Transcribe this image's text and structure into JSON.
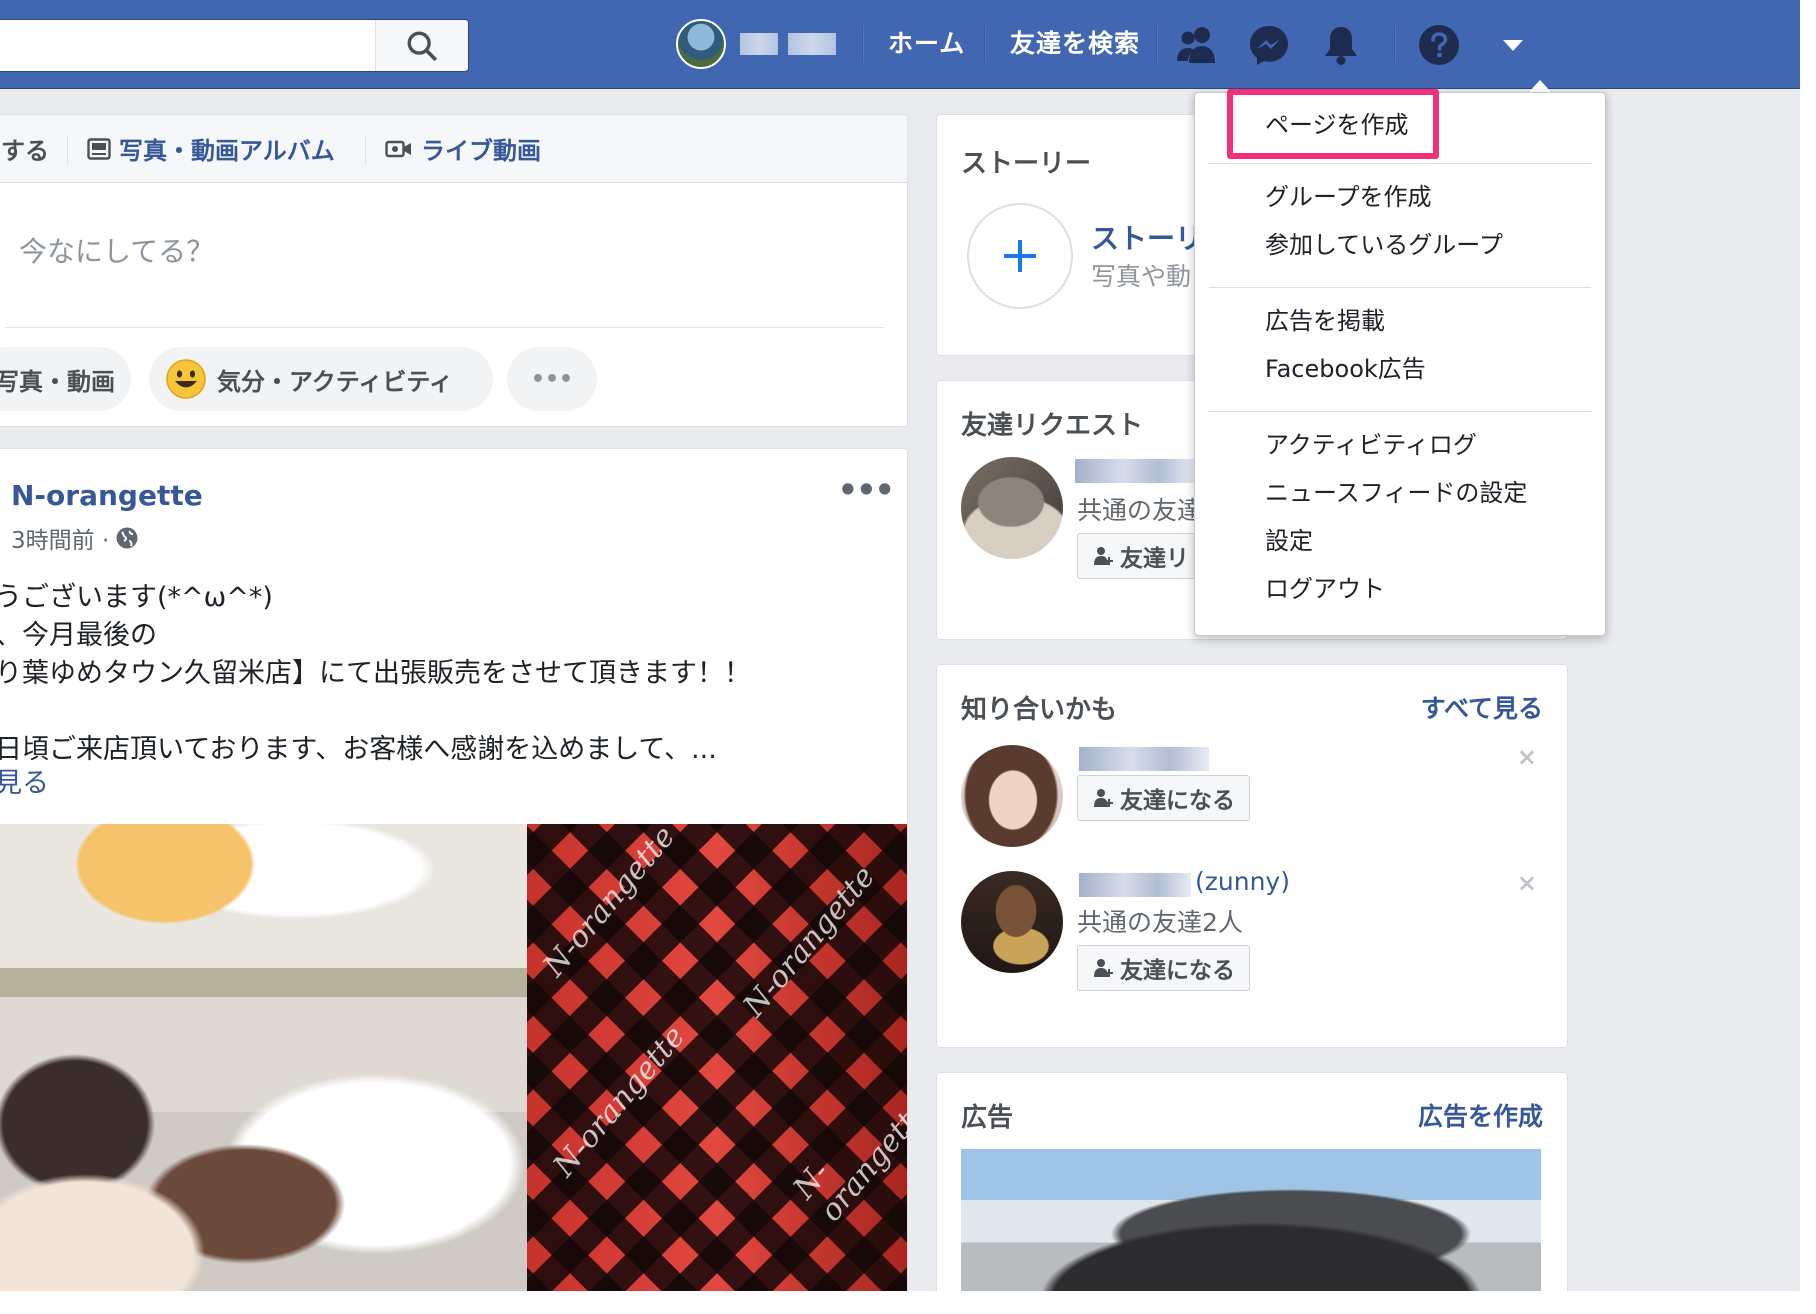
{
  "header": {
    "nav_home": "ホーム",
    "nav_find_friends": "友達を検索"
  },
  "composer": {
    "tab_post_partial": "する",
    "tab_album": "写真・動画アルバム",
    "tab_live": "ライブ動画",
    "placeholder": "今なにしてる？",
    "action_photo_partial": "写真・動画",
    "action_feeling": "気分・アクティビティ",
    "action_more": "•••"
  },
  "post": {
    "author": "N-orangette",
    "time": "3時間前 ·",
    "more": "•••",
    "lines": [
      "うございます(*^ω^*)",
      "、今月最後の",
      "り葉ゆめタウン久留米店】にて出張販売をさせて頂きます！！",
      "日頃ご来店頂いております、お客様へ感謝を込めまして、..."
    ],
    "see_more_partial": "見る",
    "image_logo_text": "N-orangette"
  },
  "stories": {
    "title": "ストーリー",
    "item_title_partial": "ストーリ",
    "item_sub_partial": "写真や動"
  },
  "friend_requests": {
    "title": "友達リクエスト",
    "mutual_partial": "共通の友達",
    "button_partial": "友達リ"
  },
  "people_you_may_know": {
    "title": "知り合いかも",
    "see_all": "すべて見る",
    "people": [
      {
        "name": "",
        "mutual": "",
        "button": "友達になる"
      },
      {
        "name": "(zunny)",
        "mutual": "共通の友達2人",
        "button": "友達になる"
      }
    ],
    "dismiss": "×"
  },
  "ads": {
    "title": "広告",
    "create": "広告を作成"
  },
  "dropdown": {
    "items": [
      "ページを作成",
      "グループを作成",
      "参加しているグループ",
      "広告を掲載",
      "Facebook広告",
      "アクティビティログ",
      "ニュースフィードの設定",
      "設定",
      "ログアウト"
    ]
  },
  "colors": {
    "brand": "#4267b2",
    "link": "#365899",
    "highlight": "#f0307a",
    "background": "#e9ebee"
  },
  "icons": {
    "search": "search-icon",
    "friends": "friend-requests-icon",
    "messenger": "messenger-icon",
    "notifications": "bell-icon",
    "help": "help-icon",
    "menu": "caret-down-icon"
  }
}
